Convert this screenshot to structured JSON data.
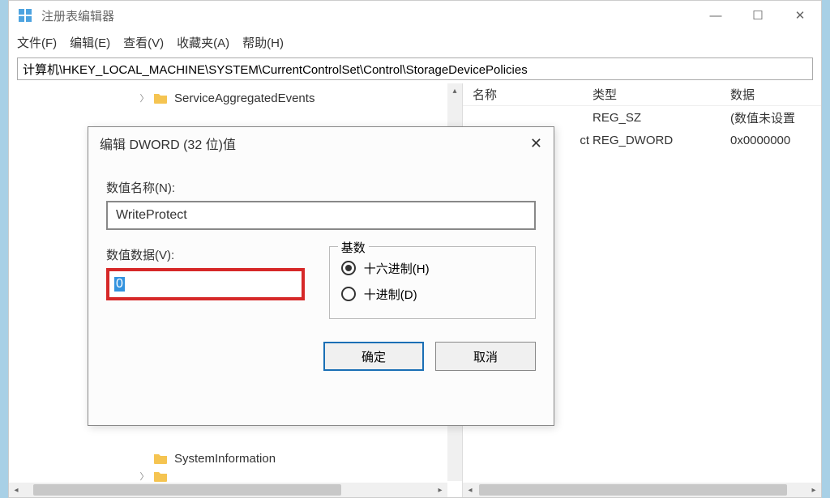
{
  "app": {
    "title": "注册表编辑器",
    "menus": [
      "文件(F)",
      "编辑(E)",
      "查看(V)",
      "收藏夹(A)",
      "帮助(H)"
    ],
    "address": "计算机\\HKEY_LOCAL_MACHINE\\SYSTEM\\CurrentControlSet\\Control\\StorageDevicePolicies"
  },
  "tree": {
    "top_item": "ServiceAggregatedEvents",
    "bottom_item": "SystemInformation"
  },
  "list": {
    "headers": {
      "name": "名称",
      "type": "类型",
      "data": "数据"
    },
    "rows": [
      {
        "name_suffix": "",
        "type": "REG_SZ",
        "data": "(数值未设置"
      },
      {
        "name_suffix": "ct",
        "type": "REG_DWORD",
        "data": "0x0000000"
      }
    ]
  },
  "dialog": {
    "title": "编辑 DWORD (32 位)值",
    "name_label": "数值名称(N):",
    "name_value": "WriteProtect",
    "data_label": "数值数据(V):",
    "data_value": "0",
    "base_legend": "基数",
    "radio_hex": "十六进制(H)",
    "radio_dec": "十进制(D)",
    "ok": "确定",
    "cancel": "取消"
  }
}
